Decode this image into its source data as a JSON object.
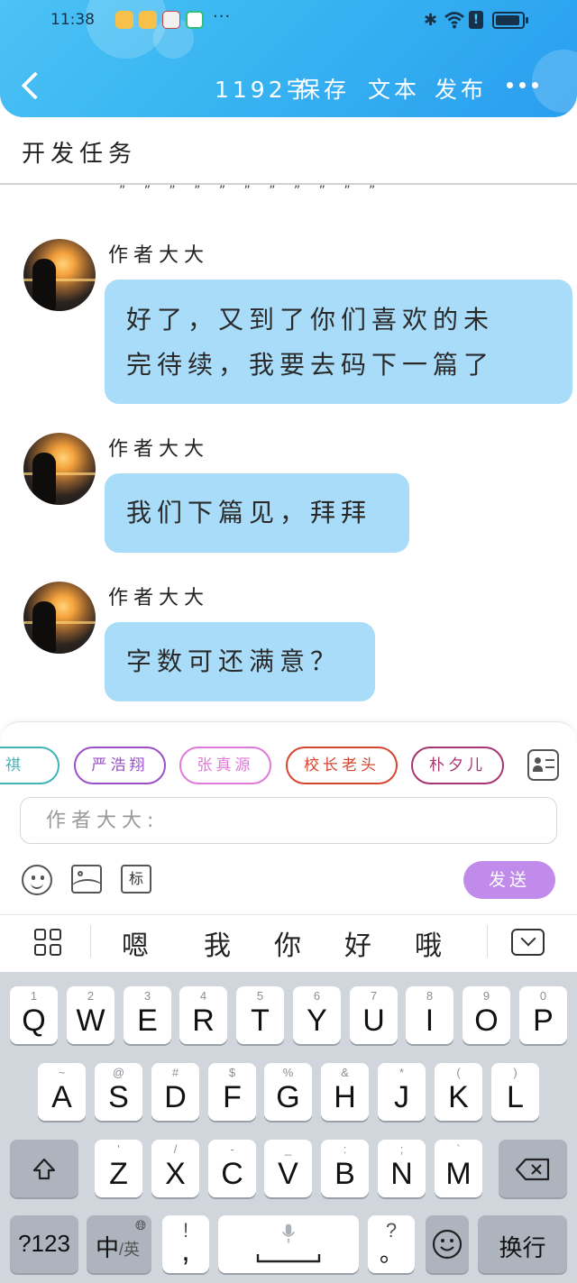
{
  "status_bar": {
    "time": "11:38",
    "more_notifications": "···"
  },
  "header": {
    "word_count": "1192字",
    "save_label": "保存",
    "text_label": "文本",
    "publish_label": "发布"
  },
  "task": {
    "title": "开发任务",
    "quote_marks": "” ” ” ” ” ” ” ” ” ” ”"
  },
  "messages": [
    {
      "author": "作者大大",
      "text_line1": "好了，又到了你们喜欢的未",
      "text_line2": "完待续，我要去码下一篇了"
    },
    {
      "author": "作者大大",
      "text_line1": "我们下篇见，拜拜"
    },
    {
      "author": "作者大大",
      "text_line1": "字数可还满意？"
    }
  ],
  "character_chips": [
    {
      "label": "祺",
      "color": "#3fb3b7"
    },
    {
      "label": "严浩翔",
      "color": "#9b4fc8"
    },
    {
      "label": "张真源",
      "color": "#e07ad8"
    },
    {
      "label": "校长老头",
      "color": "#d6452e"
    },
    {
      "label": "朴夕儿",
      "color": "#a83370"
    }
  ],
  "input": {
    "placeholder": "作者大大:",
    "tag_label": "标",
    "send_label": "发送"
  },
  "candidates": [
    "嗯",
    "我",
    "你",
    "好",
    "哦"
  ],
  "keyboard": {
    "row1": [
      {
        "key": "Q",
        "sub": "1"
      },
      {
        "key": "W",
        "sub": "2"
      },
      {
        "key": "E",
        "sub": "3"
      },
      {
        "key": "R",
        "sub": "4"
      },
      {
        "key": "T",
        "sub": "5"
      },
      {
        "key": "Y",
        "sub": "6"
      },
      {
        "key": "U",
        "sub": "7"
      },
      {
        "key": "I",
        "sub": "8"
      },
      {
        "key": "O",
        "sub": "9"
      },
      {
        "key": "P",
        "sub": "0"
      }
    ],
    "row2": [
      {
        "key": "A",
        "sub": "~"
      },
      {
        "key": "S",
        "sub": "@"
      },
      {
        "key": "D",
        "sub": "#"
      },
      {
        "key": "F",
        "sub": "$"
      },
      {
        "key": "G",
        "sub": "%"
      },
      {
        "key": "H",
        "sub": "&"
      },
      {
        "key": "J",
        "sub": "*"
      },
      {
        "key": "K",
        "sub": "("
      },
      {
        "key": "L",
        "sub": ")"
      }
    ],
    "row3": [
      {
        "key": "Z",
        "sub": "'"
      },
      {
        "key": "X",
        "sub": "/"
      },
      {
        "key": "C",
        "sub": "-"
      },
      {
        "key": "V",
        "sub": "_"
      },
      {
        "key": "B",
        "sub": ":"
      },
      {
        "key": "N",
        "sub": ";"
      },
      {
        "key": "M",
        "sub": "`"
      }
    ],
    "numbers_label": "?123",
    "lang_label_main": "中",
    "lang_label_sub": "/英",
    "comma_top": "!",
    "comma_main": ",",
    "period_top": "?",
    "period_main": "。",
    "enter_label": "换行"
  }
}
